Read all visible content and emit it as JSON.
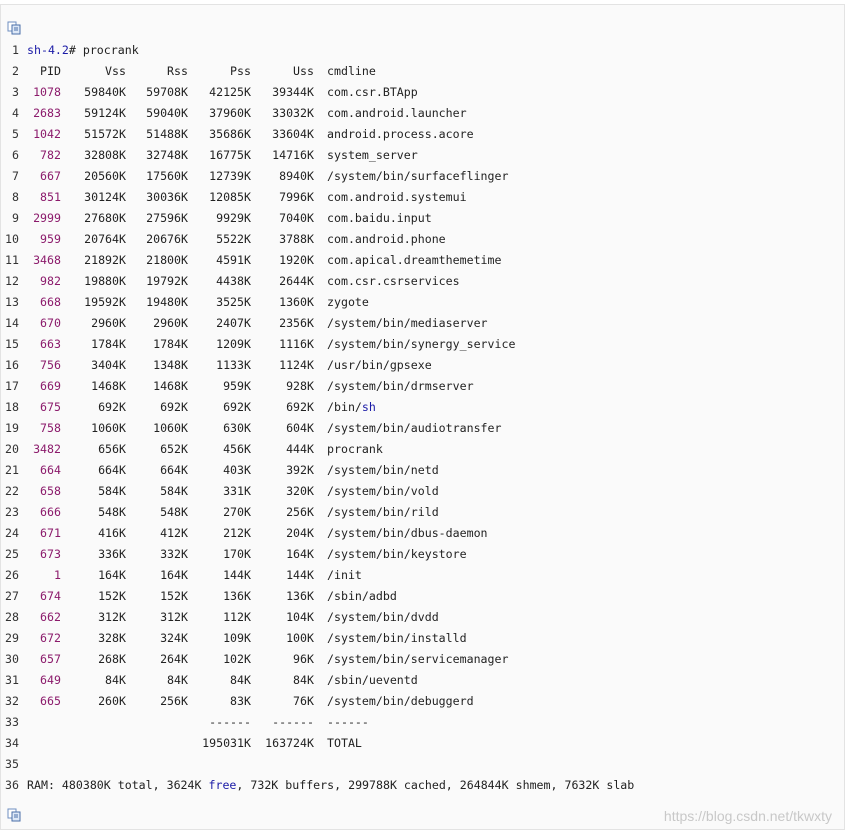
{
  "code": {
    "prompt": "sh-4.2",
    "command": "# procrank",
    "headers": [
      "PID",
      "Vss",
      "Rss",
      "Pss",
      "Uss",
      "cmdline"
    ],
    "rows": [
      {
        "pid": "1078",
        "vss": "59840K",
        "rss": "59708K",
        "pss": "42125K",
        "uss": "39344K",
        "cmd": "com.csr.BTApp"
      },
      {
        "pid": "2683",
        "vss": "59124K",
        "rss": "59040K",
        "pss": "37960K",
        "uss": "33032K",
        "cmd": "com.android.launcher"
      },
      {
        "pid": "1042",
        "vss": "51572K",
        "rss": "51488K",
        "pss": "35686K",
        "uss": "33604K",
        "cmd": "android.process.acore"
      },
      {
        "pid": "782",
        "vss": "32808K",
        "rss": "32748K",
        "pss": "16775K",
        "uss": "14716K",
        "cmd": "system_server"
      },
      {
        "pid": "667",
        "vss": "20560K",
        "rss": "17560K",
        "pss": "12739K",
        "uss": "8940K",
        "cmd": "/system/bin/surfaceflinger"
      },
      {
        "pid": "851",
        "vss": "30124K",
        "rss": "30036K",
        "pss": "12085K",
        "uss": "7996K",
        "cmd": "com.android.systemui"
      },
      {
        "pid": "2999",
        "vss": "27680K",
        "rss": "27596K",
        "pss": "9929K",
        "uss": "7040K",
        "cmd": "com.baidu.input"
      },
      {
        "pid": "959",
        "vss": "20764K",
        "rss": "20676K",
        "pss": "5522K",
        "uss": "3788K",
        "cmd": "com.android.phone"
      },
      {
        "pid": "3468",
        "vss": "21892K",
        "rss": "21800K",
        "pss": "4591K",
        "uss": "1920K",
        "cmd": "com.apical.dreamthemetime"
      },
      {
        "pid": "982",
        "vss": "19880K",
        "rss": "19792K",
        "pss": "4438K",
        "uss": "2644K",
        "cmd": "com.csr.csrservices"
      },
      {
        "pid": "668",
        "vss": "19592K",
        "rss": "19480K",
        "pss": "3525K",
        "uss": "1360K",
        "cmd": "zygote"
      },
      {
        "pid": "670",
        "vss": "2960K",
        "rss": "2960K",
        "pss": "2407K",
        "uss": "2356K",
        "cmd": "/system/bin/mediaserver"
      },
      {
        "pid": "663",
        "vss": "1784K",
        "rss": "1784K",
        "pss": "1209K",
        "uss": "1116K",
        "cmd": "/system/bin/synergy_service"
      },
      {
        "pid": "756",
        "vss": "3404K",
        "rss": "1348K",
        "pss": "1133K",
        "uss": "1124K",
        "cmd": "/usr/bin/gpsexe"
      },
      {
        "pid": "669",
        "vss": "1468K",
        "rss": "1468K",
        "pss": "959K",
        "uss": "928K",
        "cmd": "/system/bin/drmserver"
      },
      {
        "pid": "675",
        "vss": "692K",
        "rss": "692K",
        "pss": "692K",
        "uss": "692K",
        "cmd": "/bin/",
        "cmd_hl": "sh"
      },
      {
        "pid": "758",
        "vss": "1060K",
        "rss": "1060K",
        "pss": "630K",
        "uss": "604K",
        "cmd": "/system/bin/audiotransfer"
      },
      {
        "pid": "3482",
        "vss": "656K",
        "rss": "652K",
        "pss": "456K",
        "uss": "444K",
        "cmd": "procrank"
      },
      {
        "pid": "664",
        "vss": "664K",
        "rss": "664K",
        "pss": "403K",
        "uss": "392K",
        "cmd": "/system/bin/netd"
      },
      {
        "pid": "658",
        "vss": "584K",
        "rss": "584K",
        "pss": "331K",
        "uss": "320K",
        "cmd": "/system/bin/vold"
      },
      {
        "pid": "666",
        "vss": "548K",
        "rss": "548K",
        "pss": "270K",
        "uss": "256K",
        "cmd": "/system/bin/rild"
      },
      {
        "pid": "671",
        "vss": "416K",
        "rss": "412K",
        "pss": "212K",
        "uss": "204K",
        "cmd": "/system/bin/dbus-daemon"
      },
      {
        "pid": "673",
        "vss": "336K",
        "rss": "332K",
        "pss": "170K",
        "uss": "164K",
        "cmd": "/system/bin/keystore"
      },
      {
        "pid": "1",
        "vss": "164K",
        "rss": "164K",
        "pss": "144K",
        "uss": "144K",
        "cmd": "/init"
      },
      {
        "pid": "674",
        "vss": "152K",
        "rss": "152K",
        "pss": "136K",
        "uss": "136K",
        "cmd": "/sbin/adbd"
      },
      {
        "pid": "662",
        "vss": "312K",
        "rss": "312K",
        "pss": "112K",
        "uss": "104K",
        "cmd": "/system/bin/dvdd"
      },
      {
        "pid": "672",
        "vss": "328K",
        "rss": "324K",
        "pss": "109K",
        "uss": "100K",
        "cmd": "/system/bin/installd"
      },
      {
        "pid": "657",
        "vss": "268K",
        "rss": "264K",
        "pss": "102K",
        "uss": "96K",
        "cmd": "/system/bin/servicemanager"
      },
      {
        "pid": "649",
        "vss": "84K",
        "rss": "84K",
        "pss": "84K",
        "uss": "84K",
        "cmd": "/sbin/ueventd"
      },
      {
        "pid": "665",
        "vss": "260K",
        "rss": "256K",
        "pss": "83K",
        "uss": "76K",
        "cmd": "/system/bin/debuggerd"
      }
    ],
    "separator": {
      "pss": "------",
      "uss": "------",
      "cmd": "------"
    },
    "totals": {
      "pss": "195031K",
      "uss": "163724K",
      "cmd": "TOTAL"
    },
    "ram": {
      "prefix": "RAM: 480380K total, 3624K ",
      "highlight": "free",
      "suffix": ", 732K buffers, 299788K cached, 264844K shmem, 7632K slab"
    },
    "line_numbers": [
      "1",
      "2",
      "3",
      "4",
      "5",
      "6",
      "7",
      "8",
      "9",
      "10",
      "11",
      "12",
      "13",
      "14",
      "15",
      "16",
      "17",
      "18",
      "19",
      "20",
      "21",
      "22",
      "23",
      "24",
      "25",
      "26",
      "27",
      "28",
      "29",
      "30",
      "31",
      "32",
      "33",
      "34",
      "35",
      "36"
    ]
  },
  "watermark": "https://blog.csdn.net/tkwxty",
  "icons": {
    "copy": "copy-icon"
  }
}
